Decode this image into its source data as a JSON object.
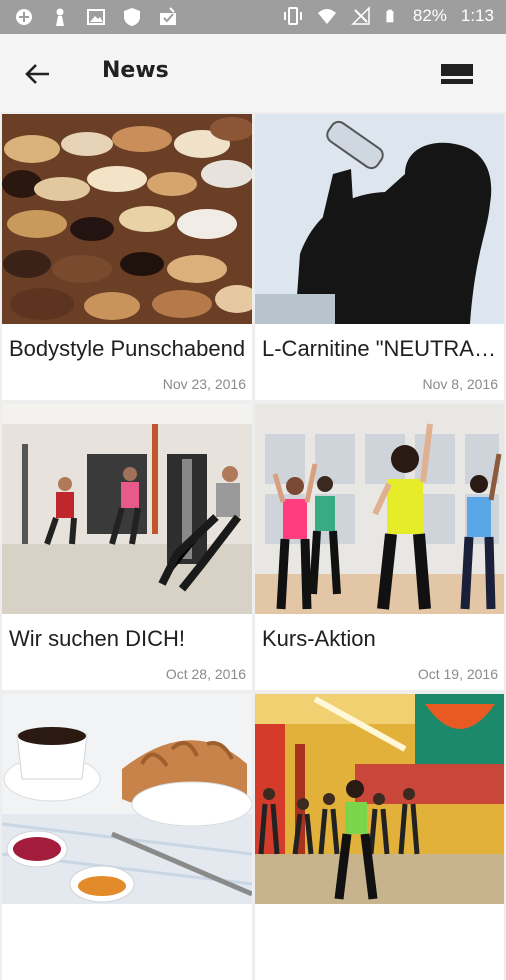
{
  "status_bar": {
    "battery": "82%",
    "time": "1:13"
  },
  "app_bar": {
    "title": "News",
    "back_icon": "arrow-back-icon",
    "view_icon": "view-stream-icon"
  },
  "news": [
    {
      "title": "Bodystyle Punschabend",
      "date": "Nov 23, 2016",
      "image": "cookies-photo"
    },
    {
      "title": "L-Carnitine \"NEUTRAL\"...",
      "date": "Nov 8, 2016",
      "image": "drinking-silhouette-photo"
    },
    {
      "title": "Wir suchen DICH!",
      "date": "Oct 28, 2016",
      "image": "gym-machines-photo"
    },
    {
      "title": "Kurs-Aktion",
      "date": "Oct 19, 2016",
      "image": "dance-class-photo"
    },
    {
      "title": "",
      "date": "",
      "image": "breakfast-photo"
    },
    {
      "title": "",
      "date": "",
      "image": "studio-class-photo"
    }
  ]
}
